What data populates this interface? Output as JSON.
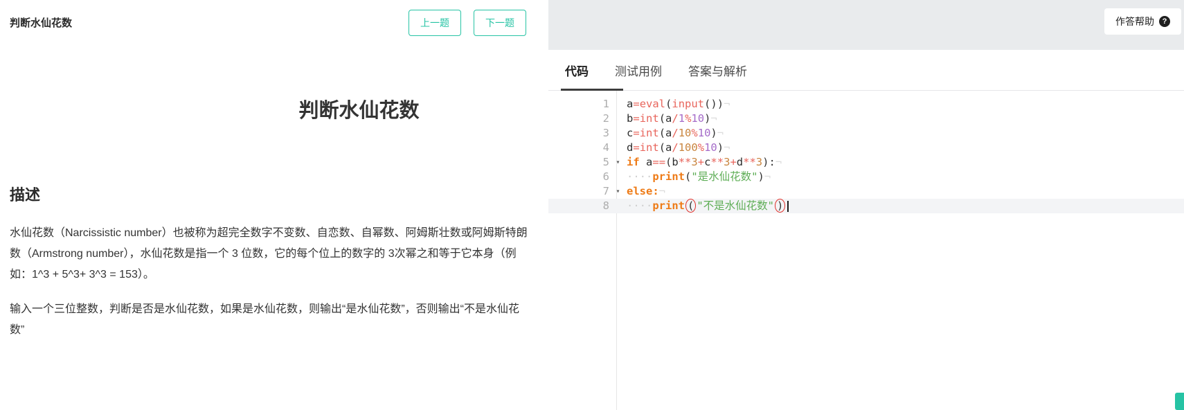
{
  "page": {
    "header": {
      "title": "判断水仙花数",
      "prev_btn": "上一题",
      "next_btn": "下一题"
    },
    "help_btn": {
      "label": "作答帮助",
      "icon": "?"
    },
    "problem": {
      "title": "判断水仙花数",
      "section_heading": "描述",
      "paragraph1": "水仙花数（Narcissistic number）也被称为超完全数字不变数、自恋数、自幂数、阿姆斯壮数或阿姆斯特朗数（Armstrong number），水仙花数是指一个 3 位数，它的每个位上的数字的 3次幂之和等于它本身（例如：1^3 + 5^3+ 3^3 = 153）。",
      "paragraph2": "输入一个三位整数，判断是否是水仙花数，如果是水仙花数，则输出“是水仙花数”，否则输出“不是水仙花数”"
    },
    "tabs": [
      {
        "id": "code",
        "label": "代码",
        "active": true
      },
      {
        "id": "testcases",
        "label": "测试用例",
        "active": false
      },
      {
        "id": "analysis",
        "label": "答案与解析",
        "active": false
      }
    ],
    "colors": {
      "accent_teal": "#26c3a4",
      "strip_gray": "#e9ebed",
      "keyword_orange": "#ee7b17",
      "builtin_red": "#e8655c",
      "number_purple": "#a56cc9",
      "number_orange": "#c9853f",
      "string_green": "#5fae57",
      "bracket_error_red": "#e0302a"
    }
  },
  "editor": {
    "fold_icon": "▾",
    "eol_marker": "¬",
    "lines": [
      {
        "no": "1",
        "fold": false,
        "active": false,
        "segments": [
          {
            "t": "a",
            "c": "v"
          },
          {
            "t": "=",
            "c": "op"
          },
          {
            "t": "eval",
            "c": "bi"
          },
          {
            "t": "(",
            "c": "p"
          },
          {
            "t": "input",
            "c": "bi"
          },
          {
            "t": "(",
            "c": "p"
          },
          {
            "t": ")",
            "c": "p"
          },
          {
            "t": ")",
            "c": "p"
          },
          {
            "t": "¬",
            "c": "eol"
          }
        ]
      },
      {
        "no": "2",
        "fold": false,
        "active": false,
        "segments": [
          {
            "t": "b",
            "c": "v"
          },
          {
            "t": "=",
            "c": "op"
          },
          {
            "t": "int",
            "c": "bi"
          },
          {
            "t": "(",
            "c": "p"
          },
          {
            "t": "a",
            "c": "v"
          },
          {
            "t": "/",
            "c": "op"
          },
          {
            "t": "1",
            "c": "numP"
          },
          {
            "t": "%",
            "c": "op"
          },
          {
            "t": "10",
            "c": "numP"
          },
          {
            "t": ")",
            "c": "p"
          },
          {
            "t": "¬",
            "c": "eol"
          }
        ]
      },
      {
        "no": "3",
        "fold": false,
        "active": false,
        "segments": [
          {
            "t": "c",
            "c": "v"
          },
          {
            "t": "=",
            "c": "op"
          },
          {
            "t": "int",
            "c": "bi"
          },
          {
            "t": "(",
            "c": "p"
          },
          {
            "t": "a",
            "c": "v"
          },
          {
            "t": "/",
            "c": "op"
          },
          {
            "t": "10",
            "c": "numO"
          },
          {
            "t": "%",
            "c": "op"
          },
          {
            "t": "10",
            "c": "numP"
          },
          {
            "t": ")",
            "c": "p"
          },
          {
            "t": "¬",
            "c": "eol"
          }
        ]
      },
      {
        "no": "4",
        "fold": false,
        "active": false,
        "segments": [
          {
            "t": "d",
            "c": "v"
          },
          {
            "t": "=",
            "c": "op"
          },
          {
            "t": "int",
            "c": "bi"
          },
          {
            "t": "(",
            "c": "p"
          },
          {
            "t": "a",
            "c": "v"
          },
          {
            "t": "/",
            "c": "op"
          },
          {
            "t": "100",
            "c": "numO"
          },
          {
            "t": "%",
            "c": "op"
          },
          {
            "t": "10",
            "c": "numP"
          },
          {
            "t": ")",
            "c": "p"
          },
          {
            "t": "¬",
            "c": "eol"
          }
        ]
      },
      {
        "no": "5",
        "fold": true,
        "active": false,
        "segments": [
          {
            "t": "if",
            "c": "kw"
          },
          {
            "t": " ",
            "c": "v"
          },
          {
            "t": "a",
            "c": "v"
          },
          {
            "t": "==",
            "c": "op"
          },
          {
            "t": "(",
            "c": "p"
          },
          {
            "t": "b",
            "c": "v"
          },
          {
            "t": "**",
            "c": "op"
          },
          {
            "t": "3",
            "c": "numO"
          },
          {
            "t": "+",
            "c": "op"
          },
          {
            "t": "c",
            "c": "v"
          },
          {
            "t": "**",
            "c": "op"
          },
          {
            "t": "3",
            "c": "numO"
          },
          {
            "t": "+",
            "c": "op"
          },
          {
            "t": "d",
            "c": "v"
          },
          {
            "t": "**",
            "c": "op"
          },
          {
            "t": "3",
            "c": "numO"
          },
          {
            "t": ")",
            "c": "p"
          },
          {
            "t": ":",
            "c": "p"
          },
          {
            "t": "¬",
            "c": "eol"
          }
        ]
      },
      {
        "no": "6",
        "fold": false,
        "active": false,
        "segments": [
          {
            "t": "····",
            "c": "ws"
          },
          {
            "t": "print",
            "c": "kw"
          },
          {
            "t": "(",
            "c": "p"
          },
          {
            "t": "\"是水仙花数\"",
            "c": "str"
          },
          {
            "t": ")",
            "c": "p"
          },
          {
            "t": "¬",
            "c": "eol"
          }
        ]
      },
      {
        "no": "7",
        "fold": true,
        "active": false,
        "segments": [
          {
            "t": "else",
            "c": "kw"
          },
          {
            "t": ":",
            "c": "kw"
          },
          {
            "t": "¬",
            "c": "eol"
          }
        ]
      },
      {
        "no": "8",
        "fold": false,
        "active": true,
        "segments": [
          {
            "t": "····",
            "c": "ws"
          },
          {
            "t": "print",
            "c": "kw"
          },
          {
            "t": "(",
            "c": "errp"
          },
          {
            "t": "\"不是水仙花数\"",
            "c": "str"
          },
          {
            "t": ")",
            "c": "errp"
          },
          {
            "t": "",
            "c": "cursor"
          }
        ]
      }
    ]
  }
}
